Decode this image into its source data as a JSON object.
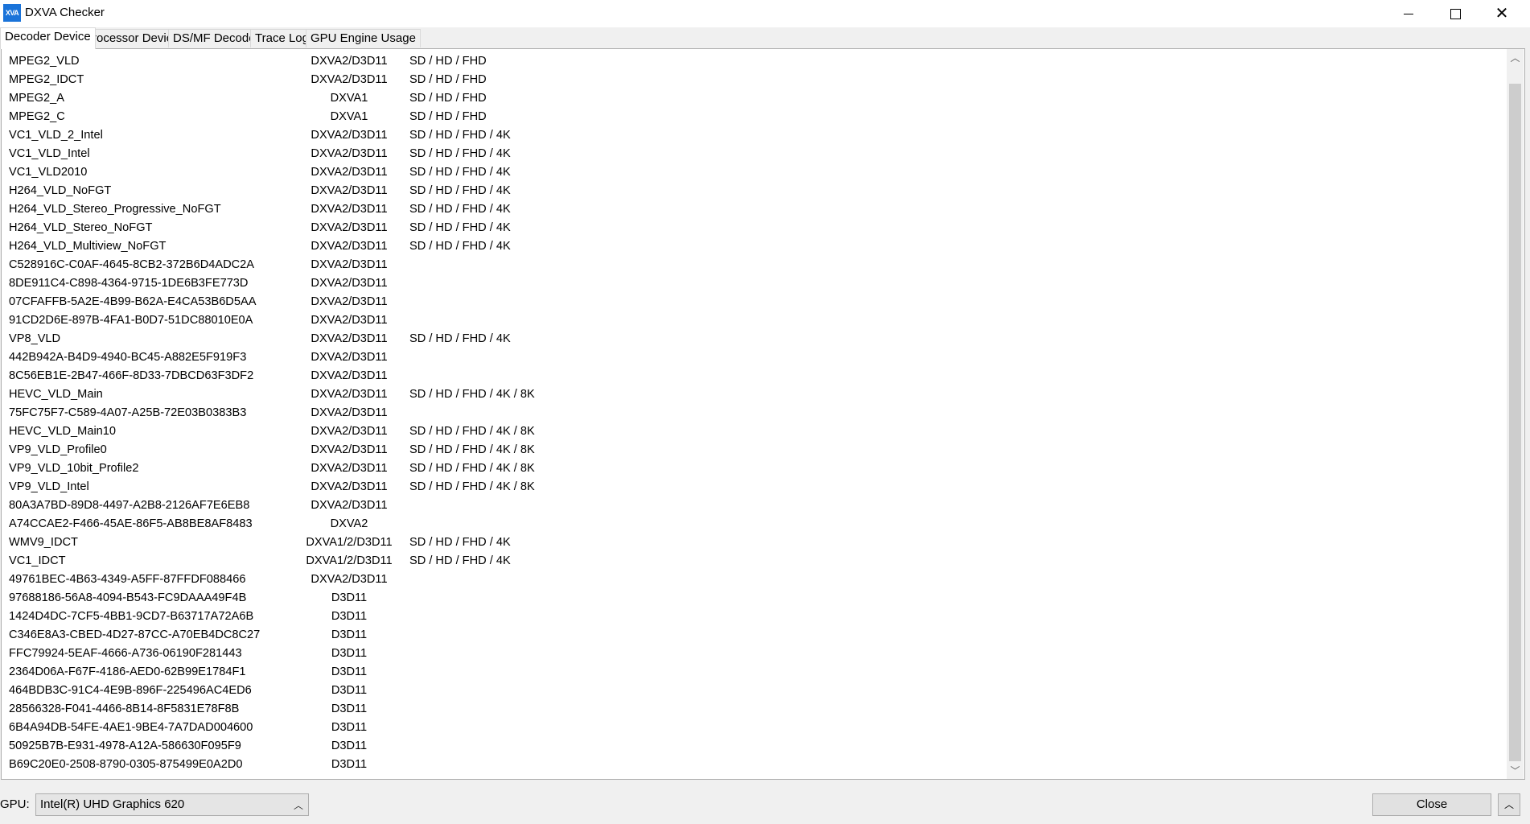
{
  "window": {
    "title": "DXVA Checker",
    "icon_text": "XVA",
    "controls": {
      "minimize": "minimize-icon",
      "maximize": "maximize-icon",
      "close": "close-icon"
    }
  },
  "tabs": [
    {
      "label": "Decoder Device",
      "active": true
    },
    {
      "label": "Processor Device",
      "active": false
    },
    {
      "label": "DS/MF Decoder",
      "active": false
    },
    {
      "label": "Trace Log",
      "active": false
    },
    {
      "label": "GPU Engine Usage",
      "active": false
    }
  ],
  "decoders": [
    {
      "name": "MPEG2_VLD",
      "api": "DXVA2/D3D11",
      "res": "SD / HD / FHD"
    },
    {
      "name": "MPEG2_IDCT",
      "api": "DXVA2/D3D11",
      "res": "SD / HD / FHD"
    },
    {
      "name": "MPEG2_A",
      "api": "DXVA1",
      "res": "SD / HD / FHD"
    },
    {
      "name": "MPEG2_C",
      "api": "DXVA1",
      "res": "SD / HD / FHD"
    },
    {
      "name": "VC1_VLD_2_Intel",
      "api": "DXVA2/D3D11",
      "res": "SD / HD / FHD / 4K"
    },
    {
      "name": "VC1_VLD_Intel",
      "api": "DXVA2/D3D11",
      "res": "SD / HD / FHD / 4K"
    },
    {
      "name": "VC1_VLD2010",
      "api": "DXVA2/D3D11",
      "res": "SD / HD / FHD / 4K"
    },
    {
      "name": "H264_VLD_NoFGT",
      "api": "DXVA2/D3D11",
      "res": "SD / HD / FHD / 4K"
    },
    {
      "name": "H264_VLD_Stereo_Progressive_NoFGT",
      "api": "DXVA2/D3D11",
      "res": "SD / HD / FHD / 4K"
    },
    {
      "name": "H264_VLD_Stereo_NoFGT",
      "api": "DXVA2/D3D11",
      "res": "SD / HD / FHD / 4K"
    },
    {
      "name": "H264_VLD_Multiview_NoFGT",
      "api": "DXVA2/D3D11",
      "res": "SD / HD / FHD / 4K"
    },
    {
      "name": "C528916C-C0AF-4645-8CB2-372B6D4ADC2A",
      "api": "DXVA2/D3D11",
      "res": ""
    },
    {
      "name": "8DE911C4-C898-4364-9715-1DE6B3FE773D",
      "api": "DXVA2/D3D11",
      "res": ""
    },
    {
      "name": "07CFAFFB-5A2E-4B99-B62A-E4CA53B6D5AA",
      "api": "DXVA2/D3D11",
      "res": ""
    },
    {
      "name": "91CD2D6E-897B-4FA1-B0D7-51DC88010E0A",
      "api": "DXVA2/D3D11",
      "res": ""
    },
    {
      "name": "VP8_VLD",
      "api": "DXVA2/D3D11",
      "res": "SD / HD / FHD / 4K"
    },
    {
      "name": "442B942A-B4D9-4940-BC45-A882E5F919F3",
      "api": "DXVA2/D3D11",
      "res": ""
    },
    {
      "name": "8C56EB1E-2B47-466F-8D33-7DBCD63F3DF2",
      "api": "DXVA2/D3D11",
      "res": ""
    },
    {
      "name": "HEVC_VLD_Main",
      "api": "DXVA2/D3D11",
      "res": "SD / HD / FHD / 4K / 8K"
    },
    {
      "name": "75FC75F7-C589-4A07-A25B-72E03B0383B3",
      "api": "DXVA2/D3D11",
      "res": ""
    },
    {
      "name": "HEVC_VLD_Main10",
      "api": "DXVA2/D3D11",
      "res": "SD / HD / FHD / 4K / 8K"
    },
    {
      "name": "VP9_VLD_Profile0",
      "api": "DXVA2/D3D11",
      "res": "SD / HD / FHD / 4K / 8K"
    },
    {
      "name": "VP9_VLD_10bit_Profile2",
      "api": "DXVA2/D3D11",
      "res": "SD / HD / FHD / 4K / 8K"
    },
    {
      "name": "VP9_VLD_Intel",
      "api": "DXVA2/D3D11",
      "res": "SD / HD / FHD / 4K / 8K"
    },
    {
      "name": "80A3A7BD-89D8-4497-A2B8-2126AF7E6EB8",
      "api": "DXVA2/D3D11",
      "res": ""
    },
    {
      "name": "A74CCAE2-F466-45AE-86F5-AB8BE8AF8483",
      "api": "DXVA2",
      "res": ""
    },
    {
      "name": "WMV9_IDCT",
      "api": "DXVA1/2/D3D11",
      "res": "SD / HD / FHD / 4K"
    },
    {
      "name": "VC1_IDCT",
      "api": "DXVA1/2/D3D11",
      "res": "SD / HD / FHD / 4K"
    },
    {
      "name": "49761BEC-4B63-4349-A5FF-87FFDF088466",
      "api": "DXVA2/D3D11",
      "res": ""
    },
    {
      "name": "97688186-56A8-4094-B543-FC9DAAA49F4B",
      "api": "D3D11",
      "res": ""
    },
    {
      "name": "1424D4DC-7CF5-4BB1-9CD7-B63717A72A6B",
      "api": "D3D11",
      "res": ""
    },
    {
      "name": "C346E8A3-CBED-4D27-87CC-A70EB4DC8C27",
      "api": "D3D11",
      "res": ""
    },
    {
      "name": "FFC79924-5EAF-4666-A736-06190F281443",
      "api": "D3D11",
      "res": ""
    },
    {
      "name": "2364D06A-F67F-4186-AED0-62B99E1784F1",
      "api": "D3D11",
      "res": ""
    },
    {
      "name": "464BDB3C-91C4-4E9B-896F-225496AC4ED6",
      "api": "D3D11",
      "res": ""
    },
    {
      "name": "28566328-F041-4466-8B14-8F5831E78F8B",
      "api": "D3D11",
      "res": ""
    },
    {
      "name": "6B4A94DB-54FE-4AE1-9BE4-7A7DAD004600",
      "api": "D3D11",
      "res": ""
    },
    {
      "name": "50925B7B-E931-4978-A12A-586630F095F9",
      "api": "D3D11",
      "res": ""
    },
    {
      "name": "B69C20E0-2508-8790-0305-875499E0A2D0",
      "api": "D3D11",
      "res": ""
    }
  ],
  "scrollbar": {
    "up_icon": "chevron-up-icon",
    "down_icon": "chevron-down-icon"
  },
  "footer": {
    "gpu_label": "GPU:",
    "gpu_value": "Intel(R) UHD Graphics 620",
    "close_label": "Close"
  }
}
